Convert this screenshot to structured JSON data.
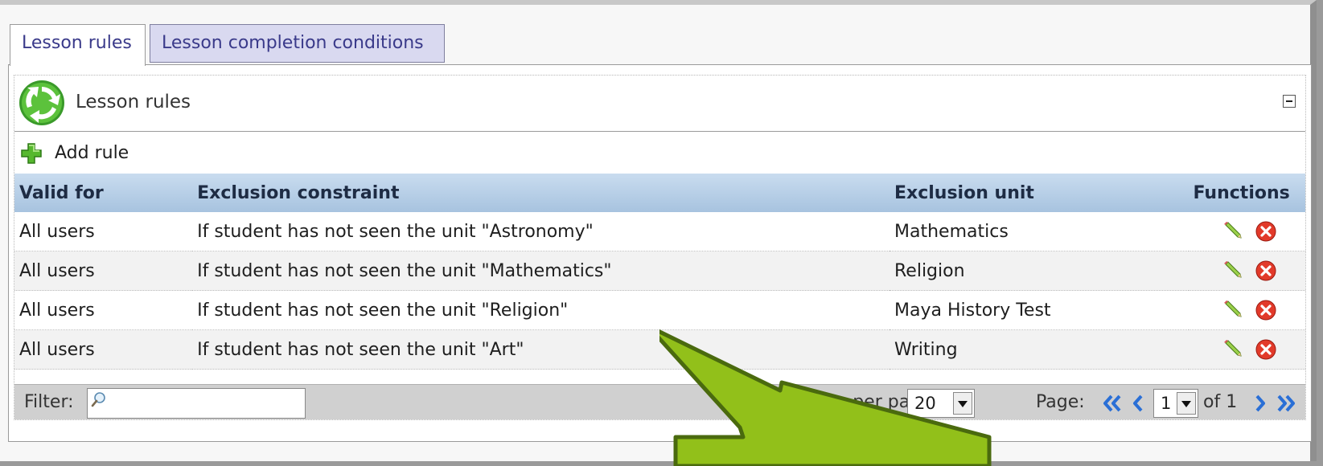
{
  "tabs": [
    {
      "label": "Lesson rules",
      "active": true
    },
    {
      "label": "Lesson completion conditions",
      "active": false
    }
  ],
  "block": {
    "title": "Lesson rules"
  },
  "toolbar": {
    "add_rule_label": "Add rule"
  },
  "table": {
    "headers": [
      "Valid for",
      "Exclusion constraint",
      "Exclusion unit",
      "Functions"
    ],
    "rows": [
      {
        "valid_for": "All users",
        "constraint": "If student has not seen the unit \"Astronomy\"",
        "unit": "Mathematics"
      },
      {
        "valid_for": "All users",
        "constraint": "If student has not seen the unit \"Mathematics\"",
        "unit": "Religion"
      },
      {
        "valid_for": "All users",
        "constraint": "If student has not seen the unit \"Religion\"",
        "unit": "Maya History Test"
      },
      {
        "valid_for": "All users",
        "constraint": "If student has not seen the unit \"Art\"",
        "unit": "Writing"
      }
    ]
  },
  "footer": {
    "filter_label": "Filter:",
    "filter_value": "",
    "rows_per_page_label": "Rows per page:",
    "rows_per_page_value": "20",
    "page_label": "Page:",
    "page_value": "1",
    "of_label": "of 1"
  },
  "icons": {
    "block": "recycle-icon",
    "add": "plus-icon",
    "edit": "pencil-icon",
    "delete": "delete-icon",
    "filter": "magnifier-icon",
    "nav": [
      "first-page-icon",
      "previous-page-icon",
      "next-page-icon",
      "last-page-icon"
    ]
  },
  "colors": {
    "header_gradient_top": "#c9dcef",
    "header_gradient_bottom": "#a7c3df",
    "inactive_tab": "#d9d9f0",
    "nav_blue": "#2a6fd6",
    "callout_green": "#8fc000"
  }
}
